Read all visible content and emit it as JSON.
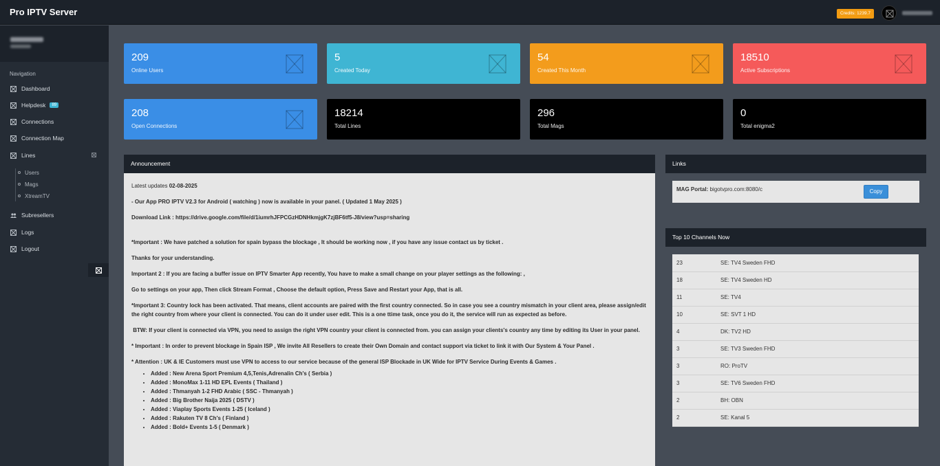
{
  "app": {
    "title": "Pro IPTV Server",
    "credits": "Credits: 1239.7"
  },
  "sidebar": {
    "heading": "Navigation",
    "items": [
      {
        "label": "Dashboard",
        "icon": "dashboard-icon"
      },
      {
        "label": "Helpdesk",
        "icon": "helpdesk-icon",
        "badge": "89"
      },
      {
        "label": "Connections",
        "icon": "connections-icon"
      },
      {
        "label": "Connection Map",
        "icon": "map-icon"
      },
      {
        "label": "Lines",
        "icon": "lines-icon"
      },
      {
        "label": "Subresellers",
        "icon": "users-icon"
      },
      {
        "label": "Logs",
        "icon": "logs-icon"
      },
      {
        "label": "Logout",
        "icon": "logout-icon"
      }
    ],
    "subitems": [
      "Users",
      "Mags",
      "XtreamTV"
    ]
  },
  "stats": [
    {
      "value": "209",
      "label": "Online Users",
      "color": "#3a8ee6"
    },
    {
      "value": "5",
      "label": "Created Today",
      "color": "#3fb5d3"
    },
    {
      "value": "54",
      "label": "Created This Month",
      "color": "#f39c1c"
    },
    {
      "value": "18510",
      "label": "Active Subscriptions",
      "color": "#f55a5a"
    },
    {
      "value": "208",
      "label": "Open Connections",
      "color": "#3a8ee6"
    },
    {
      "value": "18214",
      "label": "Total Lines",
      "color": "#000000"
    },
    {
      "value": "296",
      "label": "Total Mags",
      "color": "#000000"
    },
    {
      "value": "0",
      "label": "Total enigma2",
      "color": "#000000"
    }
  ],
  "announcement": {
    "title": "Announcement",
    "latest_prefix": "Latest updates ",
    "latest_date": "02-08-2025",
    "paragraphs": [
      "- Our App PRO IPTV V2.3 for Android ( watching ) now is available in your panel. ( Updated 1 May 2025  )",
      "Download Link : https://drive.google.com/file/d/1iumrhJFPCGzHDNHkmjgK7zjBF6tf5-J8/view?usp=sharing",
      "*Important : We have patched a solution for spain bypass the blockage , It should be working now , if you have any issue contact us by ticket .",
      "Thanks for your understanding.",
      "Important 2 : If you are facing a buffer issue on IPTV Smarter App recently, You have to make a small change on your player settings as the following: ,",
      "Go to settings on your app, Then click Stream Format , Choose the default option, Press Save  and Restart your App, that is all.",
      "*Important 3: Country lock has been activated. That means, client accounts are paired with the first country connected. So in case you see a country mismatch in your client area, please assign/edit the right country from where your client is connected. You can do it under user edit. This is a one ttime task, once you do it, the service will run as expected as before.",
      " BTW: If your client is connected via VPN, you need to assign the right VPN country your client is connected from. you can assign your clients's country any time by editing its User in your panel.",
      "* Important : In order to prevent blockage in Spain ISP , We invite All Resellers to create their Own Domain and contact support via ticket to link it with Our System & Your Panel .",
      "* Attention : UK & IE Customers must use VPN to access to our service because of the general ISP Blockade in UK Wide for IPTV Service During Events & Games ."
    ],
    "added": [
      "Added : New Arena Sport Premium 4,5,Tenis,Adrenalin Ch's ( Serbia )",
      "Added : MonoMax 1-11 HD EPL Events ( Thailand )",
      "Added : Thmanyah 1-2 FHD Arabic ( SSC - Thmanyah )",
      "Added : Big Brother Naija 2025 ( DSTV )",
      "Added : Viaplay Sports Events 1-25 ( Iceland )",
      "Added : Rakuten TV 8 Ch's ( Finland )",
      "Added : Bold+ Events 1-5 ( Denmark )"
    ]
  },
  "links": {
    "title": "Links",
    "mag_label": "MAG Portal:",
    "mag_url": "bigotvpro.com:8080/c",
    "copy_label": "Copy"
  },
  "top_channels": {
    "title": "Top 10 Channels Now",
    "rows": [
      {
        "count": "23",
        "name": "SE: TV4 Sweden FHD"
      },
      {
        "count": "18",
        "name": "SE: TV4 Sweden HD"
      },
      {
        "count": "11",
        "name": "SE: TV4"
      },
      {
        "count": "10",
        "name": "SE: SVT 1 HD"
      },
      {
        "count": "4",
        "name": "DK: TV2 HD"
      },
      {
        "count": "3",
        "name": "SE: TV3 Sweden FHD"
      },
      {
        "count": "3",
        "name": "RO: ProTV"
      },
      {
        "count": "3",
        "name": "SE: TV6 Sweden FHD"
      },
      {
        "count": "2",
        "name": "BH: OBN"
      },
      {
        "count": "2",
        "name": "SE: Kanal 5"
      }
    ]
  }
}
